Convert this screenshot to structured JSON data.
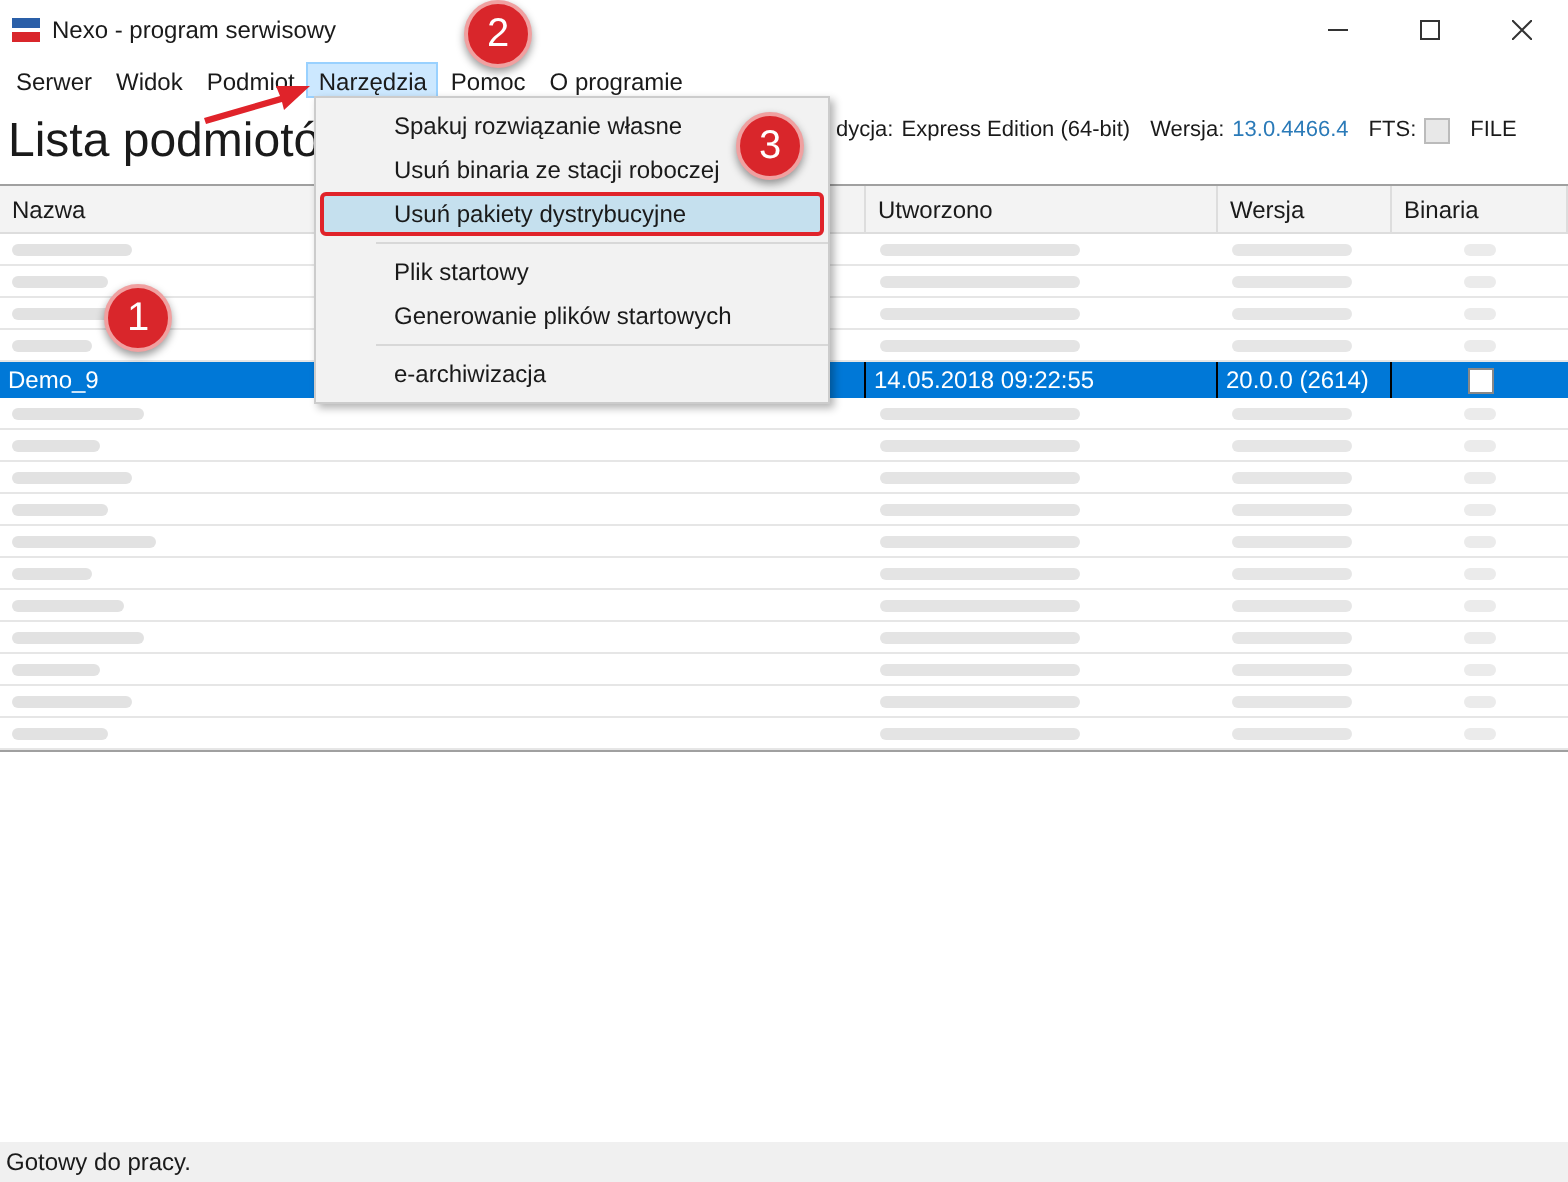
{
  "window": {
    "title": "Nexo - program serwisowy"
  },
  "menu": [
    {
      "label": "Serwer",
      "selected": false
    },
    {
      "label": "Widok",
      "selected": false
    },
    {
      "label": "Podmiot",
      "selected": false
    },
    {
      "label": "Narzędzia",
      "selected": true
    },
    {
      "label": "Pomoc",
      "selected": false
    },
    {
      "label": "O programie",
      "selected": false
    }
  ],
  "dropdown": {
    "groups": [
      [
        {
          "label": "Spakuj rozwiązanie własne",
          "selected": false
        },
        {
          "label": "Usuń binaria ze stacji roboczej",
          "selected": false
        },
        {
          "label": "Usuń pakiety dystrybucyjne",
          "selected": true
        }
      ],
      [
        {
          "label": "Plik startowy",
          "selected": false
        },
        {
          "label": "Generowanie plików startowych",
          "selected": false
        }
      ],
      [
        {
          "label": "e-archiwizacja",
          "selected": false
        }
      ]
    ]
  },
  "header": {
    "title": "Lista podmiotó",
    "edition_label": "dycja:",
    "edition": "Express Edition (64-bit)",
    "version_label": "Wersja:",
    "version": "13.0.4466.4",
    "fts_label": "FTS:",
    "fts_checked": false,
    "cut_label": "FILE"
  },
  "table": {
    "columns": [
      "Nazwa",
      "Utworzono",
      "Wersja",
      "Binaria"
    ],
    "rows": [
      {
        "kind": "picture"
      },
      {
        "kind": "picture"
      },
      {
        "kind": "picture"
      },
      {
        "kind": "picture"
      },
      {
        "kind": "data",
        "selected": true,
        "name": "Demo_9",
        "created": "14.05.2018 09:22:55",
        "version": "20.0.0 (2614)",
        "binaria": false
      },
      {
        "kind": "picture"
      },
      {
        "kind": "picture"
      },
      {
        "kind": "picture"
      },
      {
        "kind": "picture"
      },
      {
        "kind": "picture"
      },
      {
        "kind": "picture"
      },
      {
        "kind": "picture"
      },
      {
        "kind": "picture"
      },
      {
        "kind": "picture"
      },
      {
        "kind": "picture"
      },
      {
        "kind": "picture"
      }
    ]
  },
  "annotations": [
    {
      "label": "1"
    },
    {
      "label": "2"
    },
    {
      "label": "3"
    }
  ],
  "status_bar": "Gotowy do pracy."
}
